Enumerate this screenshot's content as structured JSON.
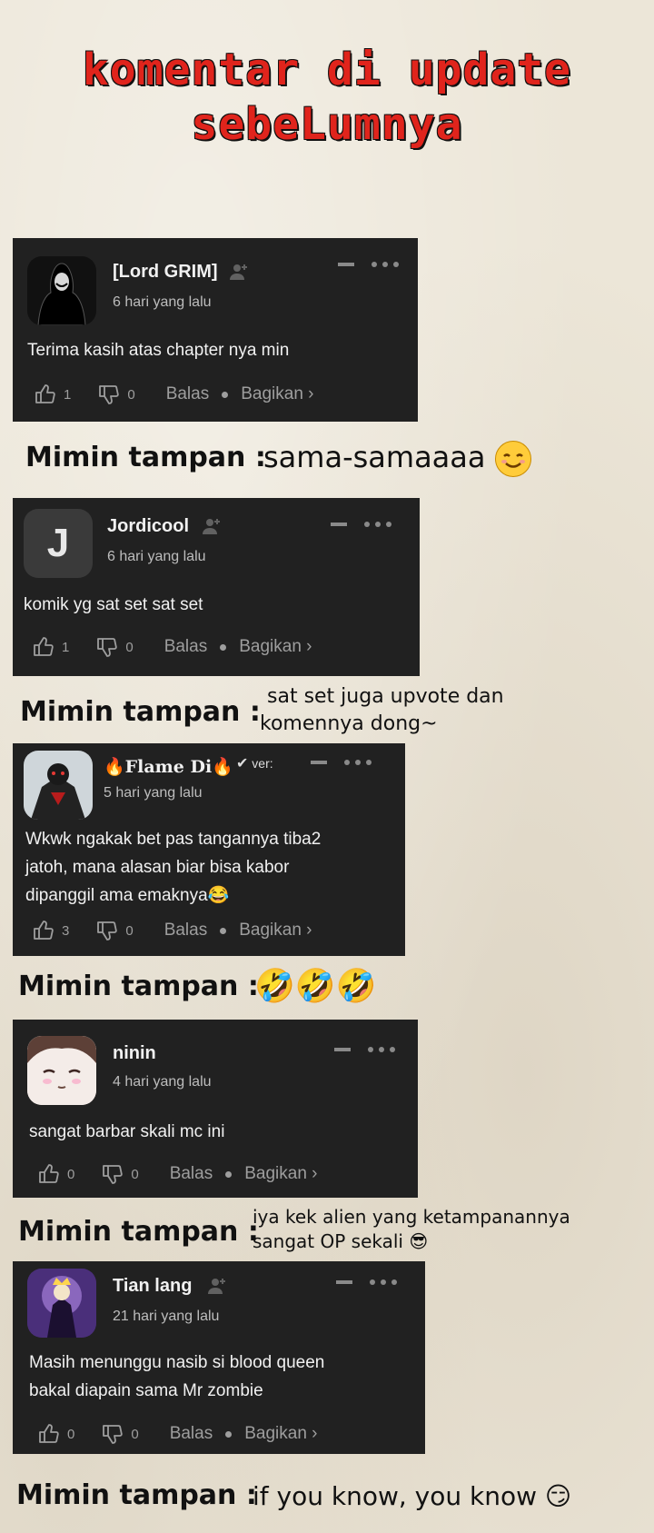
{
  "title": {
    "line1": "komentar di update",
    "line2": "sebeLumnya"
  },
  "ui": {
    "reply_label": "Balas",
    "share_label": "Bagikan ›"
  },
  "comments": [
    {
      "username": "[Lord GRIM]",
      "time": "6 hari yang lalu",
      "text": [
        "Terima kasih atas chapter nya min"
      ],
      "likes": "1",
      "dislikes": "0",
      "avatar_icon": "hooded-figure-avatar",
      "show_add_icon": true,
      "reply": {
        "label": "Mimin tampan :",
        "text": [
          "sama-samaaaa"
        ],
        "emoji": "smiling-face-emoji"
      }
    },
    {
      "username": "Jordicool",
      "time": "6 hari yang lalu",
      "text": [
        "komik yg sat set sat set"
      ],
      "likes": "1",
      "dislikes": "0",
      "avatar_letter": "J",
      "reply": {
        "label": "Mimin tampan :",
        "text": [
          "sat set juga upvote dan",
          "komennya dong~"
        ]
      }
    },
    {
      "username": "🔥Flame Di🔥",
      "badge": "ver:",
      "time": "5 hari yang lalu",
      "text": [
        "Wkwk ngakak bet pas tangannya tiba2",
        "jatoh, mana alasan biar bisa kabor",
        "dipanggil ama emaknya😂"
      ],
      "likes": "3",
      "dislikes": "0",
      "avatar_icon": "armored-warrior-avatar",
      "reply": {
        "label": "Mimin tampan :",
        "text": [
          ""
        ],
        "emoji": "rolling-laughing-emoji",
        "emoji_text": "🤣🤣🤣"
      }
    },
    {
      "username": "ninin",
      "time": "4 hari yang lalu",
      "text": [
        "sangat barbar skali mc ini"
      ],
      "likes": "0",
      "dislikes": "0",
      "avatar_icon": "anime-girl-avatar",
      "reply": {
        "label": "Mimin tampan :",
        "text": [
          "iya kek alien yang ketampanannya",
          "sangat OP sekali 😎"
        ]
      }
    },
    {
      "username": "Tian lang",
      "time": "21 hari yang lalu",
      "text": [
        "Masih menunggu nasib si blood queen",
        "bakal diapain sama Mr zombie"
      ],
      "likes": "0",
      "dislikes": "0",
      "avatar_icon": "fantasy-king-avatar",
      "reply": {
        "label": "Mimin tampan :",
        "text": [
          "if you know, you know 😏"
        ]
      }
    }
  ],
  "colors": {
    "title": "#e0241c",
    "card_bg": "#212121",
    "paper": "#ece6d8"
  }
}
